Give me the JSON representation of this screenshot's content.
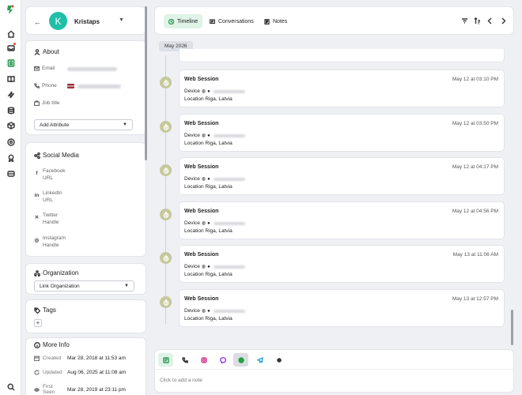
{
  "contact": {
    "initial": "K",
    "name": "Kristaps",
    "avatar_color": "#1fbfa8"
  },
  "about": {
    "title": "About",
    "email_label": "Email",
    "phone_label": "Phone",
    "job_title_label": "Job title",
    "add_attribute": "Add Attribute"
  },
  "social": {
    "title": "Social Media",
    "items": [
      {
        "line1": "Facebook",
        "line2": "URL",
        "icon": "facebook-icon"
      },
      {
        "line1": "LinkedIn",
        "line2": "URL",
        "icon": "linkedin-icon"
      },
      {
        "line1": "Twitter",
        "line2": "Handle",
        "icon": "x-twitter-icon"
      },
      {
        "line1": "Instagram",
        "line2": "Handle",
        "icon": "instagram-icon"
      }
    ]
  },
  "organization": {
    "title": "Organization",
    "link": "Link Organization"
  },
  "tags": {
    "title": "Tags",
    "add": "+"
  },
  "more_info": {
    "title": "More Info",
    "rows": [
      {
        "label": "Created",
        "value": "Mar 28, 2018 at 11:53 am"
      },
      {
        "label": "Updated",
        "value": "Aug 06, 2025 at 11:08 am"
      },
      {
        "label": "First Seen",
        "value": "Mar 28, 2019 at 23:11 pm"
      }
    ]
  },
  "tabs": [
    {
      "label": "Timeline",
      "active": true
    },
    {
      "label": "Conversations",
      "active": false
    },
    {
      "label": "Notes",
      "active": false
    }
  ],
  "month": "May 2026",
  "sessions": [
    {
      "title": "Web Session",
      "time": "May 12 at 03:10 PM",
      "device_label": "Device",
      "location": "Location Riga, Latvia"
    },
    {
      "title": "Web Session",
      "time": "May 12 at 03:50 PM",
      "device_label": "Device",
      "location": "Location Riga, Latvia"
    },
    {
      "title": "Web Session",
      "time": "May 12 at 04:17 PM",
      "device_label": "Device",
      "location": "Location Riga, Latvia"
    },
    {
      "title": "Web Session",
      "time": "May 12 at 04:56 PM",
      "device_label": "Device",
      "location": "Location Riga, Latvia"
    },
    {
      "title": "Web Session",
      "time": "May 13 at 11:06 AM",
      "device_label": "Device",
      "location": "Location Riga, Latvia"
    },
    {
      "title": "Web Session",
      "time": "May 13 at 12:57 PM",
      "device_label": "Device",
      "location": "Location Riga, Latvia"
    }
  ],
  "composer": {
    "placeholder": "Click to add a note"
  },
  "colors": {
    "accent": "#2c9a55",
    "accent_bg": "#dff3e6",
    "badge": "#c5c89a",
    "notification": "#e2493d"
  }
}
